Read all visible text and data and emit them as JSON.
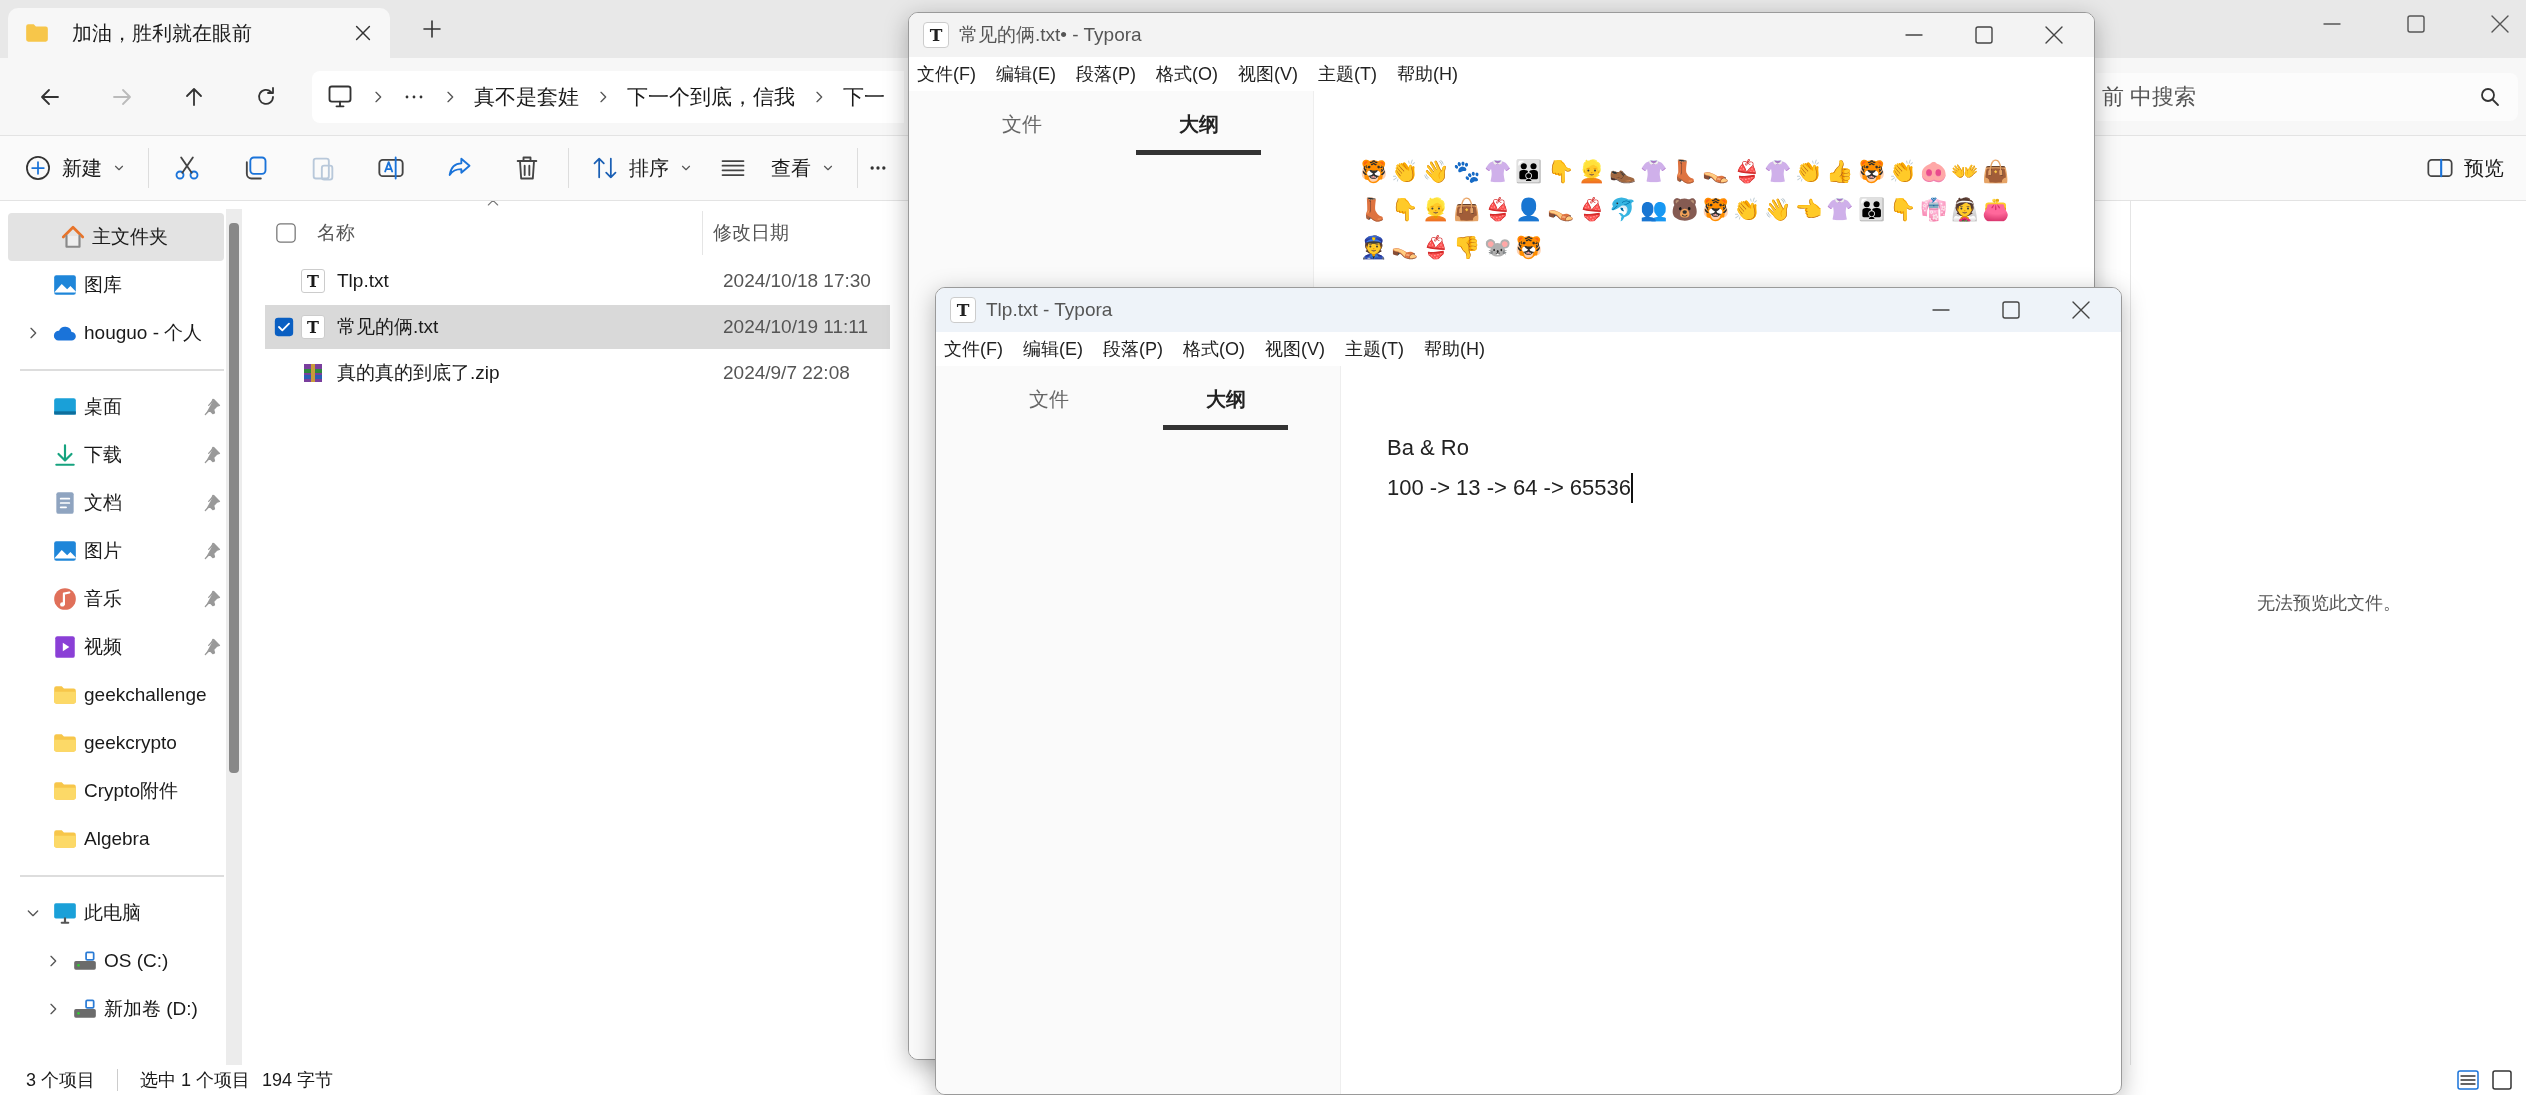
{
  "explorer": {
    "tab_title": "加油，胜利就在眼前",
    "nav": [
      {
        "disabled": false
      },
      {
        "disabled": true
      },
      {
        "disabled": false
      },
      {
        "disabled": false
      }
    ],
    "breadcrumbs": [
      "真不是套娃",
      "下一个到底，信我",
      "下一"
    ],
    "search": {
      "placeholder": "前 中搜索"
    },
    "toolbar": {
      "new_label": "新建",
      "actions": [
        {
          "disabled": false
        },
        {
          "disabled": false
        },
        {
          "disabled": true
        },
        {
          "disabled": false
        },
        {
          "disabled": false
        },
        {
          "disabled": false
        }
      ],
      "sort_label": "排序",
      "view_label": "查看",
      "preview_label": "预览"
    },
    "sidebar": {
      "sections": [
        {
          "items": [
            {
              "label": "主文件夹",
              "kind": "home",
              "selected": true
            },
            {
              "label": "图库",
              "kind": "gallery",
              "selected": false
            },
            {
              "label": "houguo - 个人",
              "kind": "cloud",
              "selected": false,
              "expanded": false
            }
          ]
        },
        {
          "items": [
            {
              "label": "桌面",
              "kind": "desktop",
              "selected": false,
              "pinned": true
            },
            {
              "label": "下载",
              "kind": "download",
              "selected": false,
              "pinned": true
            },
            {
              "label": "文档",
              "kind": "documents",
              "selected": false,
              "pinned": true
            },
            {
              "label": "图片",
              "kind": "pictures",
              "selected": false,
              "pinned": true
            },
            {
              "label": "音乐",
              "kind": "music",
              "selected": false,
              "pinned": true
            },
            {
              "label": "视频",
              "kind": "videos",
              "selected": false,
              "pinned": true
            },
            {
              "label": "geekchallenge",
              "kind": "folder",
              "selected": false
            },
            {
              "label": "geekcrypto",
              "kind": "folder",
              "selected": false
            },
            {
              "label": "Crypto附件",
              "kind": "folder",
              "selected": false
            },
            {
              "label": "Algebra",
              "kind": "folder",
              "selected": false
            }
          ]
        },
        {
          "items": [
            {
              "label": "此电脑",
              "kind": "pc",
              "selected": false,
              "expanded": true,
              "children": [
                {
                  "label": "OS (C:)",
                  "kind": "drive",
                  "selected": false,
                  "expanded": false
                },
                {
                  "label": "新加卷 (D:)",
                  "kind": "drive",
                  "selected": false,
                  "expanded": false
                }
              ]
            }
          ]
        }
      ]
    },
    "columns": [
      "名称",
      "修改日期"
    ],
    "select_all_checked": false,
    "files": [
      {
        "name": "Tlp.txt",
        "modified": "2024/10/18 17:30",
        "kind": "text",
        "icon_letter": "T",
        "selected": false
      },
      {
        "name": "常见的俩.txt",
        "modified": "2024/10/19 11:11",
        "kind": "text",
        "icon_letter": "T",
        "selected": true
      },
      {
        "name": "真的真的到底了.zip",
        "modified": "2024/9/7 22:08",
        "kind": "archive",
        "selected": false
      }
    ],
    "preview_message": "无法预览此文件。",
    "status": {
      "count": "3 个项目",
      "selection": "选中 1 个项目",
      "size": "194 字节"
    }
  },
  "windows": [
    {
      "title": "常见的俩.txt• - Typora",
      "icon_letter": "T",
      "active": false,
      "menu": [
        "文件(F)",
        "编辑(E)",
        "段落(P)",
        "格式(O)",
        "视图(V)",
        "主题(T)",
        "帮助(H)"
      ],
      "side_tabs": [
        {
          "label": "文件",
          "selected": false
        },
        {
          "label": "大纲",
          "selected": true
        }
      ],
      "kind": "emoji",
      "lines": [
        "🐯👏👋🐾👚👪👇👱👞👚👢👡👙👚👏👍🐯👏🐽👐👜👢👇👱👜👙👤👡👙🐬👥🐻🐯👏👋👈👚👪👇👘👰👛👮👡👙👎🐭🐯"
      ]
    },
    {
      "title": "Tlp.txt - Typora",
      "icon_letter": "T",
      "active": true,
      "menu": [
        "文件(F)",
        "编辑(E)",
        "段落(P)",
        "格式(O)",
        "视图(V)",
        "主题(T)",
        "帮助(H)"
      ],
      "side_tabs": [
        {
          "label": "文件",
          "selected": false
        },
        {
          "label": "大纲",
          "selected": true
        }
      ],
      "kind": "text",
      "lines": [
        "Ba & Ro",
        "100 -> 13 -> 64 -> 65536"
      ]
    }
  ]
}
